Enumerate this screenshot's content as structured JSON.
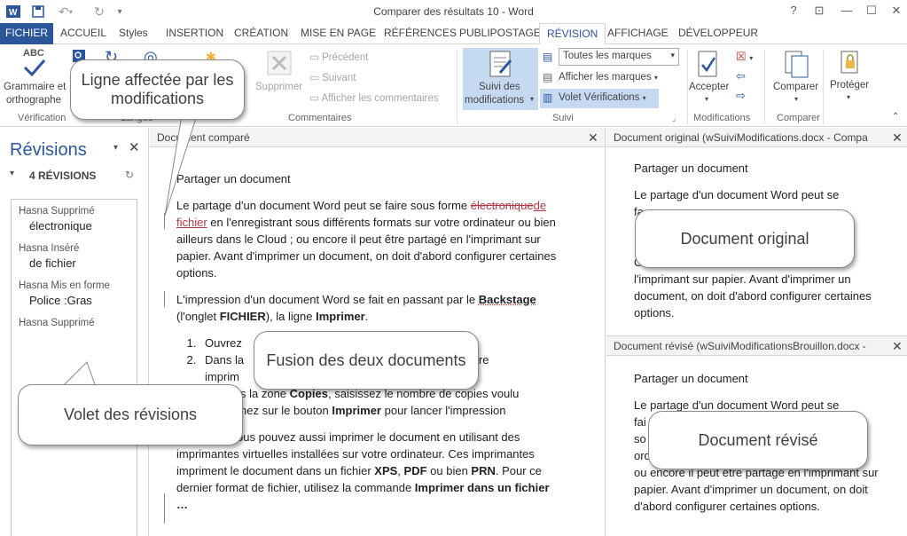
{
  "window": {
    "title": "Comparer des résultats 10 - Word",
    "controls": [
      "?",
      "⊡",
      "—",
      "☐",
      "✕"
    ]
  },
  "tabs": [
    "FICHIER",
    "ACCUEIL",
    "Styles",
    "INSERTION",
    "CRÉATION",
    "MISE EN PAGE",
    "RÉFÉRENCES",
    "PUBLIPOSTAGE",
    "RÉVISION",
    "AFFICHAGE",
    "DÉVELOPPEUR"
  ],
  "ribbon": {
    "grammar_line1": "Grammaire et",
    "grammar_line2": "orthographe",
    "abc": "ABC",
    "group_verification": "Vérification",
    "group_langue": "Langue",
    "supprimer": "Supprimer",
    "precedent": "Précédent",
    "suivant": "Suivant",
    "afficher_commentaires": "Afficher les commentaires",
    "group_commentaires": "Commentaires",
    "suivi_line1": "Suivi des",
    "suivi_line2": "modifications",
    "toutes_marques": "Toutes les marques",
    "afficher_marques": "Afficher les marques",
    "volet_verifications": "Volet Vérifications",
    "group_suivi": "Suivi",
    "accepter": "Accepter",
    "group_modifications": "Modifications",
    "comparer": "Comparer",
    "group_comparer": "Comparer",
    "proteger": "Protéger"
  },
  "revisions_pane": {
    "title": "Révisions",
    "count": "4 RÉVISIONS",
    "items": [
      {
        "author": "Hasna Supprimé",
        "text": "électronique"
      },
      {
        "author": "Hasna Inséré",
        "text": "de fichier"
      },
      {
        "author": "Hasna Mis en forme",
        "text": "Police :Gras"
      },
      {
        "author": "Hasna Supprimé",
        "text": ""
      }
    ]
  },
  "compared_doc": {
    "header": "Document comparé",
    "heading": "Partager un document",
    "p1_a": "Le partage d'un document Word peut se faire sous forme",
    "p1_del": "électronique",
    "p1_ins": "de fichier",
    "p1_b": " en l'enregistrant sous différents formats sur votre ordinateur ou bien ailleurs dans le Cloud ; ou encore il peut être partagé en l'imprimant sur papier. Avant d'imprimer un document, on doit d'abord configurer certaines options.",
    "p2_a": "L'impression d'un document Word se fait en passant par le ",
    "p2_b1": "Backstage",
    "p2_c": " (l'onglet ",
    "p2_b2": "FICHIER",
    "p2_d": "), la ligne ",
    "p2_b3": "Imprimer",
    "p2_e": ".",
    "step1_a": "Ouvrez",
    "step1_b": "mprimer",
    "step2_a": "Dans la",
    "step2_b": "otre",
    "step2_c": "imprim",
    "step3_a": "s la zone ",
    "step3_b": "Copies",
    "step3_c": ", saisissez le nombre de copies voulu",
    "step4_a": "nez sur le bouton ",
    "step4_b": "Imprimer",
    "step4_c": " pour lancer l'impression",
    "p3_a": "ous pouvez aussi imprimer le document en utilisant des imprimantes virtuelles installées sur votre ordinateur. Ces imprimantes impriment le document dans un fichier ",
    "p3_b1": "XPS",
    "p3_c": ", ",
    "p3_b2": "PDF",
    "p3_d": " ou bien ",
    "p3_b3": "PRN",
    "p3_e": ". Pour ce dernier format de fichier, utilisez la commande ",
    "p3_b4": "Imprimer dans un fichier …"
  },
  "original_doc": {
    "header": "Document original (wSuiviModifications.docx - Compa",
    "heading": "Partager un document",
    "p1": "Le partage d'un document Word peut se",
    "p1_frag": "fa",
    "p2_frag": "C",
    "p3": "l'imprimant sur papier. Avant d'imprimer un document, on doit d'abord configurer certaines options."
  },
  "revised_doc": {
    "header": "Document révisé (wSuiviModificationsBrouillon.docx -",
    "heading": "Partager un document",
    "p1": "Le partage d'un document Word peut se",
    "frag1": "fai",
    "frag2": "so",
    "frag3": "ord",
    "p2": "ou encore il peut être partagé en l'imprimant sur papier. Avant d'imprimer un document, on doit d'abord configurer certaines options."
  },
  "callouts": {
    "ligne": "Ligne affectée par les modifications",
    "original": "Document original",
    "fusion": "Fusion des deux documents",
    "volet": "Volet des révisions",
    "revise": "Document révisé"
  },
  "colors": {
    "word_blue": "#2b579a",
    "revision_red": "#b3384a",
    "highlight": "#c5d9f1"
  }
}
